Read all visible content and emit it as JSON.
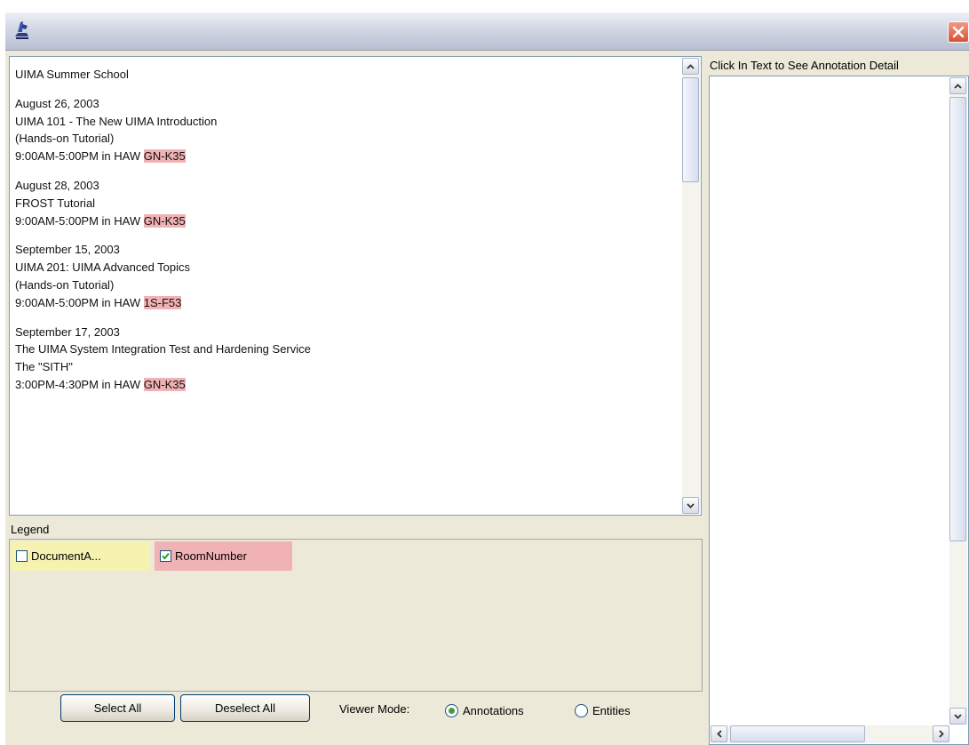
{
  "window": {
    "icon": "app-logo-icon",
    "close_icon": "close-icon"
  },
  "document": {
    "lines": [
      {
        "text": "UIMA Summer School"
      },
      {
        "gap": true
      },
      {
        "text": "August 26, 2003"
      },
      {
        "text": "UIMA 101 - The New UIMA Introduction"
      },
      {
        "text": "(Hands-on Tutorial)"
      },
      {
        "text": "9:00AM-5:00PM in HAW ",
        "room": "GN-K35"
      },
      {
        "gap": true
      },
      {
        "text": "August 28, 2003"
      },
      {
        "text": "FROST Tutorial"
      },
      {
        "text": "9:00AM-5:00PM in HAW ",
        "room": "GN-K35"
      },
      {
        "gap": true
      },
      {
        "text": "September 15, 2003"
      },
      {
        "text": "UIMA 201: UIMA Advanced Topics"
      },
      {
        "text": "(Hands-on Tutorial)"
      },
      {
        "text": "9:00AM-5:00PM in HAW ",
        "room": "1S-F53"
      },
      {
        "gap": true
      },
      {
        "text": "September 17, 2003"
      },
      {
        "text": "The UIMA System Integration Test and Hardening Service"
      },
      {
        "text": "The \"SITH\""
      },
      {
        "text": "3:00PM-4:30PM in HAW ",
        "room": "GN-K35"
      }
    ]
  },
  "legend": {
    "label": "Legend",
    "items": [
      {
        "label": "DocumentA...",
        "checked": false,
        "color": "#f6f3b1"
      },
      {
        "label": "RoomNumber",
        "checked": true,
        "color": "#f1b2b5"
      }
    ]
  },
  "controls": {
    "select_all": "Select All",
    "deselect_all": "Deselect All",
    "viewer_mode_label": "Viewer Mode:",
    "modes": [
      {
        "label": "Annotations",
        "selected": true
      },
      {
        "label": "Entities",
        "selected": false
      }
    ]
  },
  "details": {
    "title": "Click In Text to See Annotation Detail"
  }
}
